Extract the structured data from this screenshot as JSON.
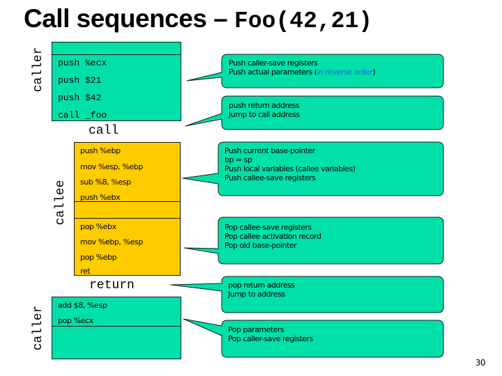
{
  "title": {
    "main": "Call sequences – ",
    "code": "Foo(42,21)"
  },
  "labels": {
    "caller_top": "caller",
    "callee": "callee",
    "caller_bottom": "caller",
    "call": "call",
    "return": "return"
  },
  "caller_top_box": {
    "instructions": [
      "push %ecx",
      "push $21",
      "push $42",
      "call _foo"
    ]
  },
  "callee_box": {
    "prologue": [
      "push %ebp",
      "mov %esp, %ebp",
      "sub %8, %esp",
      "push %ebx"
    ],
    "epilogue": [
      "pop %ebx",
      "mov %ebp, %esp",
      "pop %ebp",
      "ret"
    ]
  },
  "caller_bottom_box": {
    "instructions": [
      "add $8, %esp",
      "pop %ecx"
    ]
  },
  "callouts": [
    {
      "lines": [
        "Push caller-save registers",
        "Push actual parameters ("
      ],
      "highlight": "in reverse order",
      "suffix": ")"
    },
    {
      "lines": [
        "push return address",
        "Jump to call address"
      ]
    },
    {
      "lines": [
        "Push current base-pointer",
        "bp = sp",
        "Push local variables (callee variables)",
        "Push callee-save registers"
      ]
    },
    {
      "lines": [
        "Pop callee-save registers",
        "Pop callee activation record",
        "Pop old base-pointer"
      ]
    },
    {
      "lines": [
        "pop return address",
        "Jump to address"
      ]
    },
    {
      "lines": [
        "Pop parameters",
        "Pop caller-save registers"
      ]
    }
  ],
  "colors": {
    "caller_fill": "#00e0a8",
    "callee_fill": "#ffcc00",
    "callout_fill": "#00e0a8",
    "highlight_text": "#1a6ad6"
  },
  "page_number": "30"
}
